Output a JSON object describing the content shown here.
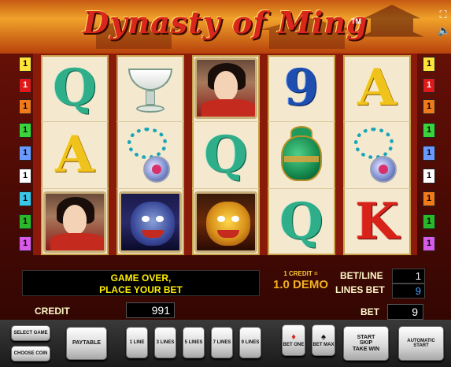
{
  "header": {
    "title": "Dynasty of Ming",
    "trademark": "TM"
  },
  "window_controls": {
    "fullscreen_icon": "expand-icon",
    "sound_icon": "speaker-muted-icon"
  },
  "reels": [
    [
      "Q",
      "A",
      "woman"
    ],
    [
      "cup",
      "beads",
      "blue-lion"
    ],
    [
      "woman",
      "Q",
      "golden-lion"
    ],
    [
      "9",
      "vase",
      "Q"
    ],
    [
      "A",
      "beads",
      "K"
    ]
  ],
  "line_markers": {
    "left": [
      "1",
      "1",
      "1",
      "1",
      "1",
      "1",
      "1",
      "1",
      "1"
    ],
    "right": [
      "1",
      "1",
      "1",
      "1",
      "1",
      "1",
      "1",
      "1",
      "1"
    ]
  },
  "info": {
    "message_line1": "GAME OVER,",
    "message_line2": "PLACE YOUR BET",
    "credit_equals": "1 CREDIT =",
    "denomination": "1.0 DEMO",
    "bet_line_label": "BET/LINE",
    "bet_line_value": "1",
    "lines_bet_label": "LINES BET",
    "lines_bet_value": "9",
    "credit_label": "CREDIT",
    "credit_value": "991",
    "bet_label": "BET",
    "bet_value": "9"
  },
  "buttons": {
    "select_game": "SELECT GAME",
    "choose_coin": "CHOOSE COIN",
    "paytable": "PAYTABLE",
    "line1": "1 LINE",
    "line3": "3 LINES",
    "line5": "5 LINES",
    "line7": "7 LINES",
    "line9": "9 LINES",
    "bet_one": "BET ONE",
    "bet_max": "BET MAX",
    "start": "START",
    "skip": "SKIP",
    "take_win": "TAKE WIN",
    "automatic_start": "AUTOMATIC START"
  },
  "colors": {
    "message_text": "#ffee00",
    "demo_text": "#f0b020",
    "lines_bet_value": "#4aa8ff"
  }
}
